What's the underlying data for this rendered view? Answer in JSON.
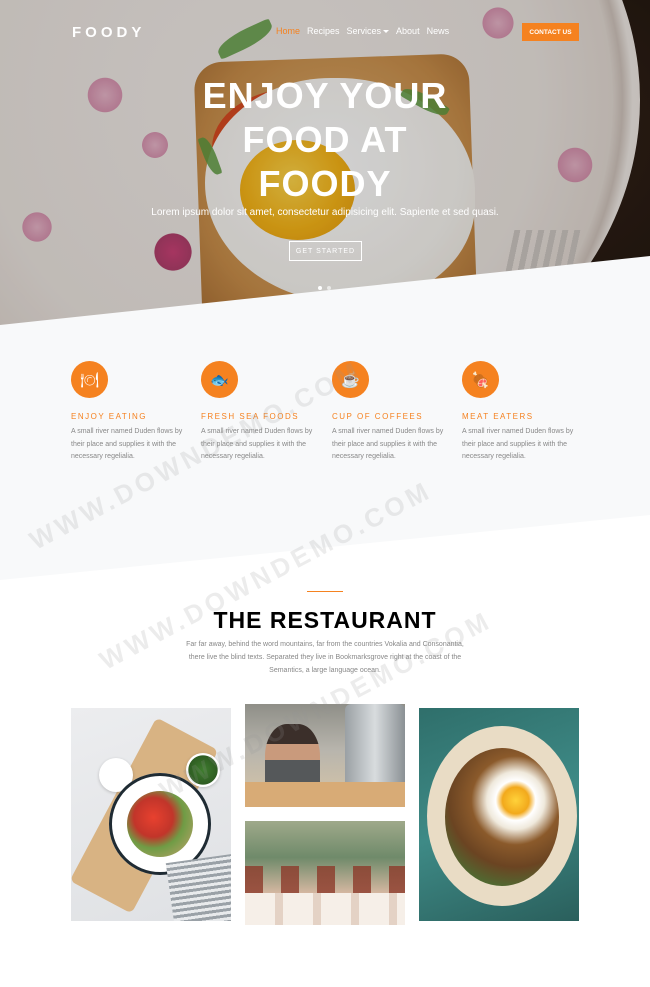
{
  "nav": {
    "logo": "FOODY",
    "items": [
      {
        "label": "Home",
        "active": true
      },
      {
        "label": "Recipes",
        "active": false
      },
      {
        "label": "Services",
        "active": false,
        "dropdown": true
      },
      {
        "label": "About",
        "active": false
      },
      {
        "label": "News",
        "active": false
      }
    ],
    "contact_label": "CONTACT US"
  },
  "hero": {
    "title_lines": [
      "ENJOY YOUR",
      "FOOD AT",
      "FOODY"
    ],
    "subtitle": "Lorem ipsum dolor sit amet, consectetur adipisicing elit. Sapiente et sed quasi.",
    "button_label": "GET STARTED",
    "slides": 2,
    "active_slide": 1
  },
  "features": [
    {
      "icon": "plate-cutlery-icon",
      "glyph": "🍽",
      "title": "ENJOY EATING",
      "text": "A small river named Duden flows by their place and supplies it with the necessary regelialia."
    },
    {
      "icon": "fish-icon",
      "glyph": "🐟",
      "title": "FRESH SEA FOODS",
      "text": "A small river named Duden flows by their place and supplies it with the necessary regelialia."
    },
    {
      "icon": "coffee-cup-icon",
      "glyph": "☕",
      "title": "CUP OF COFFEES",
      "text": "A small river named Duden flows by their place and supplies it with the necessary regelialia."
    },
    {
      "icon": "meat-icon",
      "glyph": "🍖",
      "title": "MEAT EATERS",
      "text": "A small river named Duden flows by their place and supplies it with the necessary regelialia."
    }
  ],
  "restaurant": {
    "title": "THE RESTAURANT",
    "text": "Far far away, behind the word mountains, far from the countries Vokalia and Consonantia, there live the blind texts. Separated they live in Bookmarksgrove right at the coast of the Semantics, a large language ocean."
  },
  "watermark": "WWW.DOWNDEMO.COM",
  "colors": {
    "accent": "#f58220",
    "text_muted": "#888888",
    "section_bg": "#f8f9fa"
  }
}
